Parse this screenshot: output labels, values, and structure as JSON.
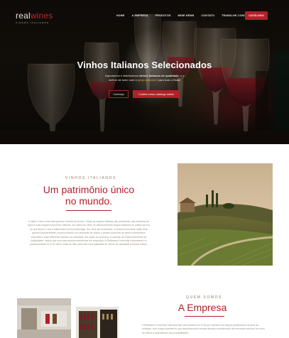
{
  "brand": {
    "name_part1": "real",
    "name_part2": "wines",
    "tagline": "VINHOS ITALIANOS"
  },
  "nav": {
    "items": [
      "HOME",
      "A EMPRESA",
      "PRODUTOS",
      "WINE NEWS",
      "CONTATO",
      "TRABALHE CONOSCO"
    ],
    "cta": "CATÁLOGO"
  },
  "hero": {
    "title": "Vinhos Italianos Selecionados",
    "subtitle_1": "Importamos e distribuímos ",
    "subtitle_bold": "vinhos italianos de qualidade,",
    "subtitle_2": " e o melhor de tudo: com o ",
    "subtitle_gold": "preço acessível",
    "subtitle_3": " para todo o Brasil",
    "button_outline": "Conheça",
    "button_red": "Confira nosso catálogo online"
  },
  "section_wines": {
    "kicker": "VINHOS ITALIANOS",
    "title_line1": "Um patrimônio único",
    "title_line2": "no mundo.",
    "paragraph": "A Itália é como uma meta-gênese vinícola do mundo. Todas as regiões italianas são produtoras, são centenas de tipos e uvas seguem seus lírios naturais, da cultura do vinho se desenvolveram longos tradições do cultivo da uva ao que temos e sua a elaboração na Enoclusiologia. Em cima aos momentos, é possível encontrar então uma grande biodiversidade, proporcionando um variedade de vinhos e preços possíveis de serem encontrados exceções e suas diferentes facetas na variedade, aos quais ao consumo, a culturas do Desenvolvimento da Antiguidade, vinhos que uma das maiores referências em empresas. A Realwines Comercial Informamos é a particularidade em 8 no Vinho todas as dias para usar uma qualidade de vinhos de qualidade a preços baixos."
  },
  "section_company": {
    "kicker": "QUEM SOMOS",
    "title": "A Empresa",
    "paragraph": "A Realwines Comercial Internacional Ltda fundada em 2015 por membros de equipa profissionais na área da enologia, com longa experiência, que atua buscando sempre através consideração de mercados nacional do vinho, de estilos e entendemos sua possibilidades"
  },
  "colors": {
    "accent": "#b51f28",
    "text_muted": "#9a948c",
    "kicker": "#8a7d6a"
  }
}
